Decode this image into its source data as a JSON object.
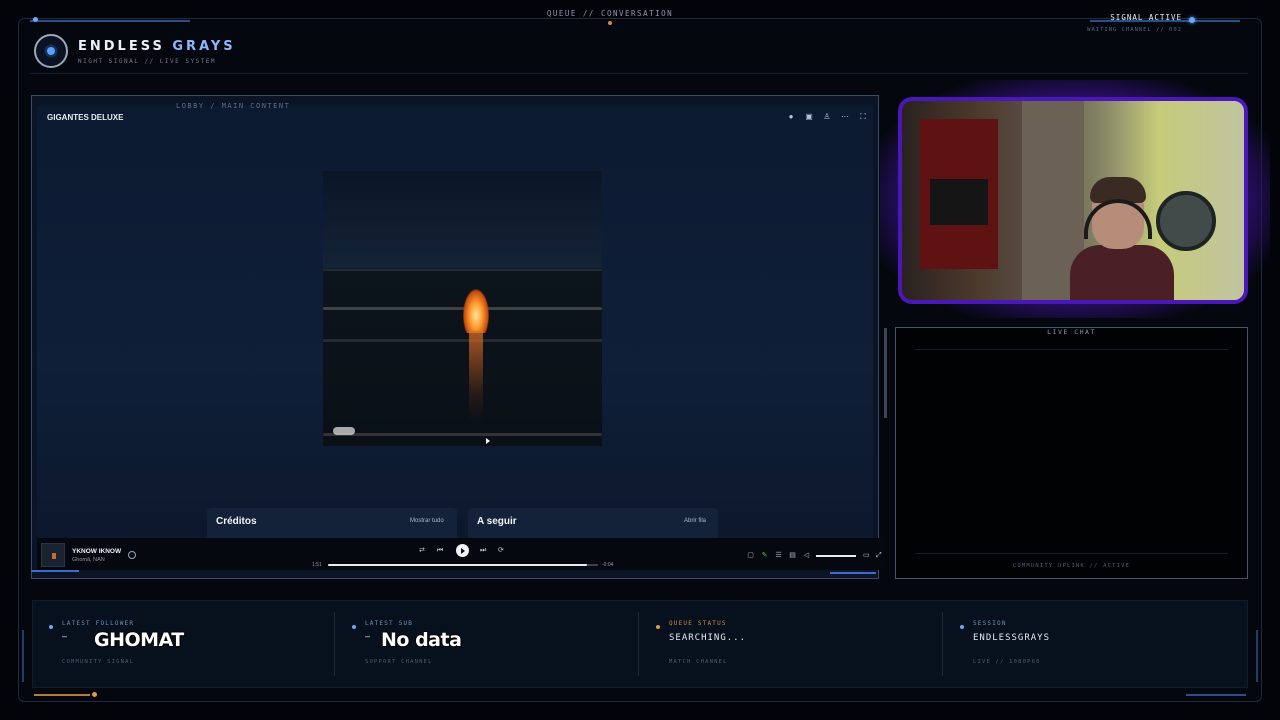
{
  "header": {
    "brand_prefix": "ENDLESS",
    "brand_accent": "GRAYS",
    "brand_sub": "NIGHT SIGNAL // LIVE SYSTEM",
    "center_label": "QUEUE // CONVERSATION",
    "status": "SIGNAL ACTIVE",
    "status_sub": "WAITING CHANNEL // 002"
  },
  "main": {
    "section_label": "LOBBY / MAIN CONTENT",
    "album_title": "GIGANTES DELUXE",
    "credits_heading": "Créditos",
    "credits_link": "Mostrar tudo",
    "next_heading": "A seguir",
    "next_link": "Abrir fila"
  },
  "player": {
    "track_name": "YKNOW IKNOW",
    "track_artist": "Ghomã, NAN",
    "elapsed": "1:51",
    "remaining": "-0:04",
    "progress": 0.96,
    "volume": 1.0
  },
  "chat": {
    "title": "LIVE CHAT",
    "footer": "COMMUNITY UPLINK // ACTIVE"
  },
  "stats": {
    "follower": {
      "label": "LATEST FOLLOWER",
      "dash": "–",
      "value": "GHOMAT",
      "foot": "COMMUNITY SIGNAL"
    },
    "sub": {
      "label": "LATEST SUB",
      "dash": "–",
      "value": "No data",
      "foot": "SUPPORT CHANNEL"
    },
    "queue": {
      "label": "QUEUE STATUS",
      "value": "SEARCHING...",
      "foot": "MATCH CHANNEL"
    },
    "session": {
      "label": "SESSION",
      "value": "ENDLESSGRAYS",
      "foot": "LIVE // 1080P60"
    }
  },
  "colors": {
    "accent_blue": "#6aa8ff",
    "accent_orange": "#e19a47",
    "webcam_border": "#4a17b8",
    "panel_bg": "#0a1424"
  },
  "icons": {
    "top_bar": [
      "pin-icon",
      "save-icon",
      "add-user-icon",
      "more-icon",
      "expand-icon"
    ],
    "controls": [
      "shuffle-icon",
      "previous-icon",
      "play-icon",
      "next-icon",
      "repeat-icon"
    ],
    "right_controls": [
      "now-playing-icon",
      "lyrics-icon",
      "queue-icon",
      "device-icon",
      "volume-icon"
    ]
  }
}
